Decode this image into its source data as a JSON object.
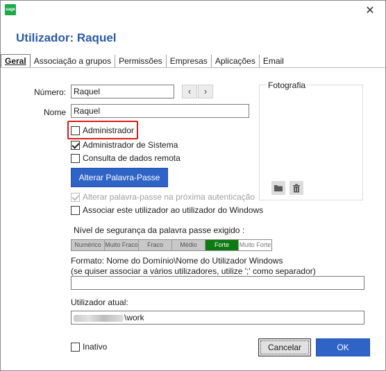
{
  "window": {
    "app_icon_text": "sage",
    "close_glyph": "✕"
  },
  "header": {
    "title": "Utilizador: Raquel"
  },
  "tabs": [
    {
      "label": "Geral",
      "active": true
    },
    {
      "label": "Associação a grupos",
      "active": false
    },
    {
      "label": "Permissões",
      "active": false
    },
    {
      "label": "Empresas",
      "active": false
    },
    {
      "label": "Aplicações",
      "active": false
    },
    {
      "label": "Email",
      "active": false
    }
  ],
  "form": {
    "numero_label": "Número:",
    "numero_value": "Raquel",
    "prev_glyph": "‹",
    "next_glyph": "›",
    "nome_label": "Nome",
    "nome_value": "Raquel",
    "administrador_label": "Administrador",
    "administrador_checked": false,
    "admin_sistema_label": "Administrador de Sistema",
    "admin_sistema_checked": true,
    "consulta_label": "Consulta de dados remota",
    "consulta_checked": false,
    "alterar_password_button": "Alterar Palavra-Passe",
    "alterar_proxima_label": "Alterar palavra-passe na próxima autenticação",
    "alterar_proxima_checked": true,
    "associar_windows_label": "Associar este utilizador ao utilizador do Windows",
    "associar_windows_checked": false
  },
  "photo": {
    "label": "Fotografia",
    "folder_icon": "folder-icon",
    "delete_icon": "trash-icon"
  },
  "security": {
    "label": "Nível de segurança da palavra passe exigido :",
    "levels": [
      "Numérico",
      "Muito Fraco",
      "Fraco",
      "Médio",
      "Forte",
      "Muito Forte"
    ],
    "selected": "Forte"
  },
  "windows_user": {
    "format_line1": "Formato: Nome do Domínio\\Nome do Utilizador Windows",
    "format_line2": "(se quiser associar a vários utilizadores, utilize ';' como separador)",
    "value": ""
  },
  "current_user": {
    "label": "Utilizador atual:",
    "value_suffix": "\\work"
  },
  "footer": {
    "inativo_label": "Inativo",
    "inativo_checked": false,
    "cancel_label": "Cancelar",
    "ok_label": "OK"
  },
  "colors": {
    "title": "#2b5aa6",
    "primary_button": "#2f63c6",
    "selected_level": "#0e7a12",
    "highlight_border": "#e01818"
  }
}
